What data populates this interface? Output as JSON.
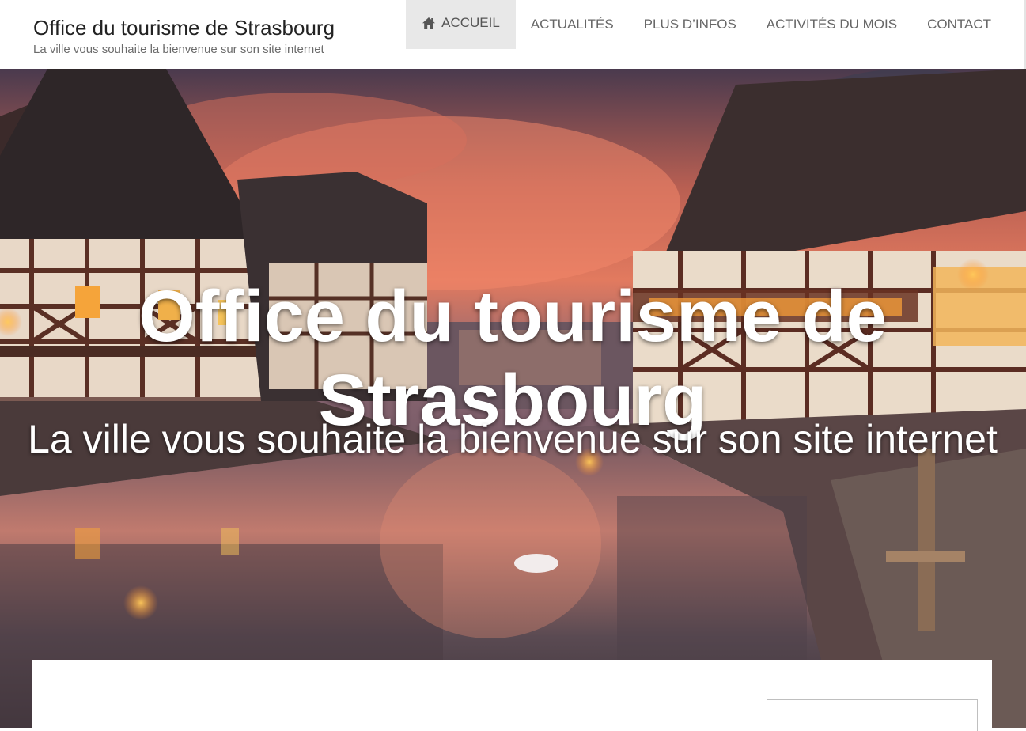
{
  "header": {
    "site_title": "Office du tourisme de Strasbourg",
    "tagline": "La ville vous souhaite la bienvenue sur son site internet"
  },
  "nav": {
    "items": [
      {
        "label": "ACCUEIL",
        "icon": "home-icon",
        "active": true
      },
      {
        "label": "ACTUALITÉS",
        "active": false
      },
      {
        "label": "PLUS D’INFOS",
        "active": false
      },
      {
        "label": "ACTIVITÉS DU MOIS",
        "active": false
      },
      {
        "label": "CONTACT",
        "active": false
      }
    ]
  },
  "hero": {
    "title": "Office du tourisme de Strasbourg",
    "subtitle": "La ville vous souhaite la bienvenue sur son site internet",
    "image": "Strasbourg Petite France canal with half-timbered houses at dusk"
  },
  "colors": {
    "nav_active_bg": "#e8e8e8",
    "nav_text": "#666666",
    "title_text": "#222222",
    "tagline_text": "#6b6b6b"
  }
}
